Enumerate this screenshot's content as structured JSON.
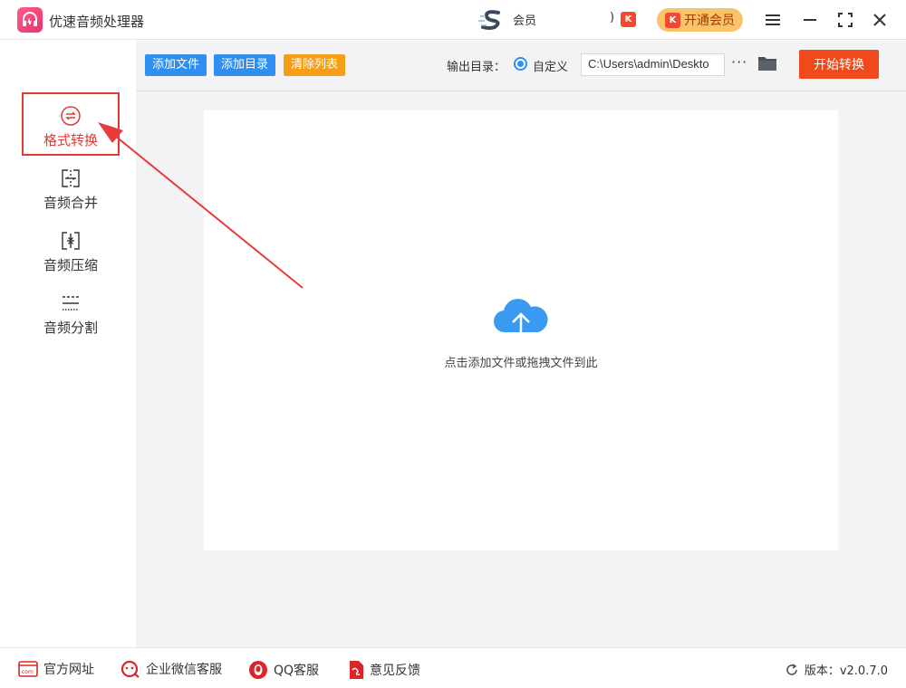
{
  "app": {
    "title": "优速音频处理器"
  },
  "promo": {
    "text": "会员",
    "suffix": ")"
  },
  "vip": {
    "label": "开通会员",
    "badge": "K"
  },
  "sidebar": {
    "items": [
      {
        "label": "格式转换",
        "active": true
      },
      {
        "label": "音频合并",
        "active": false
      },
      {
        "label": "音频压缩",
        "active": false
      },
      {
        "label": "音频分割",
        "active": false
      }
    ]
  },
  "toolbar": {
    "add_file": "添加文件",
    "add_dir": "添加目录",
    "clear_list": "清除列表",
    "output_label": "输出目录：",
    "radio_label": "自定义",
    "path_value": "C:\\Users\\admin\\Deskto",
    "more": "···",
    "start": "开始转换"
  },
  "dropzone": {
    "text": "点击添加文件或拖拽文件到此"
  },
  "footer": {
    "website": "官方网址",
    "wechat": "企业微信客服",
    "qq": "QQ客服",
    "feedback": "意见反馈",
    "version": "版本：v2.0.7.0"
  },
  "colors": {
    "accent": "#2f8ef0",
    "danger": "#e53935",
    "start": "#f04a1c",
    "orange": "#f59e1a"
  }
}
